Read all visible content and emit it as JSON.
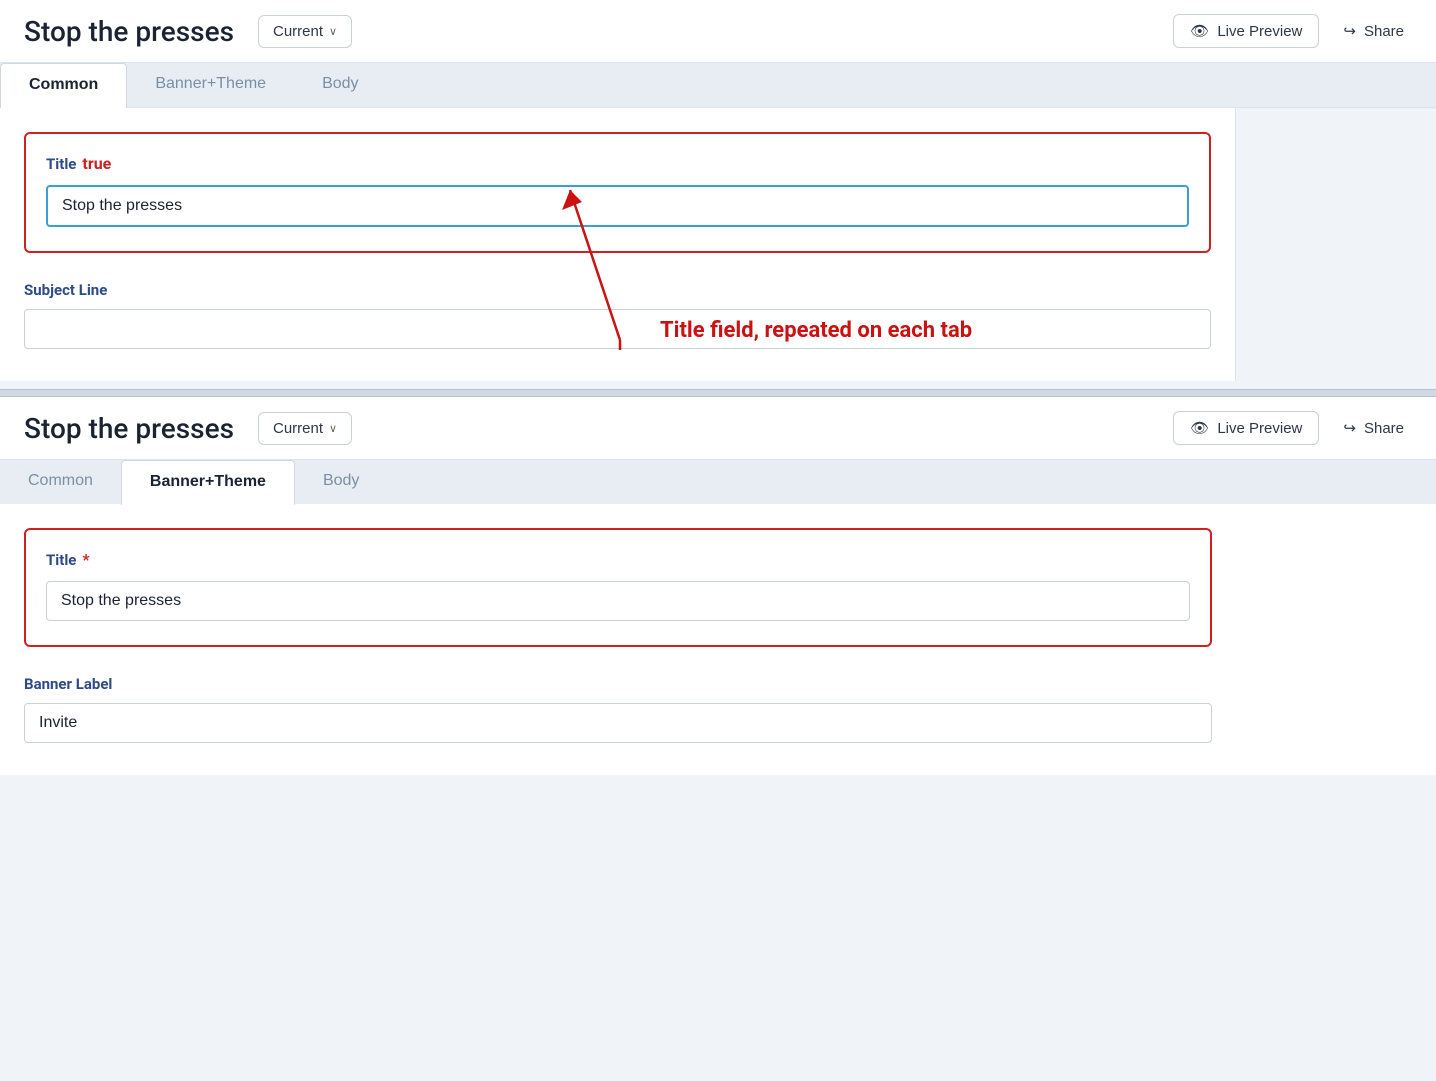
{
  "topPanel": {
    "title": "Stop the presses",
    "currentButton": "Current",
    "chevron": "∨",
    "livePreviewLabel": "Live Preview",
    "shareLabel": "Share",
    "tabs": [
      {
        "id": "common",
        "label": "Common",
        "active": true
      },
      {
        "id": "banner-theme",
        "label": "Banner+Theme",
        "active": false
      },
      {
        "id": "body",
        "label": "Body",
        "active": false
      }
    ],
    "titleField": {
      "label": "Title",
      "required": true,
      "value": "Stop the presses",
      "placeholder": ""
    },
    "subjectLineField": {
      "label": "Subject Line",
      "value": "",
      "placeholder": ""
    }
  },
  "annotation": {
    "text": "Title field, repeated on each tab"
  },
  "bottomPanel": {
    "title": "Stop the presses",
    "currentButton": "Current",
    "chevron": "∨",
    "livePreviewLabel": "Live Preview",
    "shareLabel": "Share",
    "tabs": [
      {
        "id": "common",
        "label": "Common",
        "active": false
      },
      {
        "id": "banner-theme",
        "label": "Banner+Theme",
        "active": true
      },
      {
        "id": "body",
        "label": "Body",
        "active": false
      }
    ],
    "titleField": {
      "label": "Title",
      "required": true,
      "value": "Stop the presses",
      "placeholder": ""
    },
    "bannerLabelField": {
      "label": "Banner Label",
      "value": "Invite",
      "placeholder": ""
    }
  },
  "icons": {
    "eye": "👁",
    "share": "↪",
    "chevronDown": "∨"
  }
}
